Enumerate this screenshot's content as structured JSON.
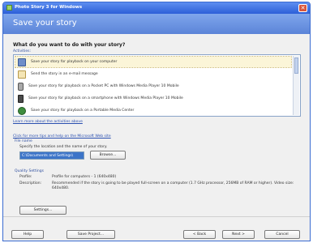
{
  "window": {
    "title": "Photo Story 3 for Windows",
    "close_glyph": "✕"
  },
  "header": {
    "title": "Save your story"
  },
  "main": {
    "question": "What do you want to do with your story?",
    "activities_label": "Activities:",
    "activities": [
      {
        "icon": "computer-icon",
        "label": "Save your story for playback on your computer"
      },
      {
        "icon": "email-icon",
        "label": "Send the story in an e-mail message"
      },
      {
        "icon": "pocket-pc-icon",
        "label": "Save your story for playback on a Pocket PC with Windows Media Player 10 Mobile"
      },
      {
        "icon": "smartphone-icon",
        "label": "Save your story for playback on a smartphone with Windows Media Player 10 Mobile"
      },
      {
        "icon": "media-center-icon",
        "label": "Save your story for playback on a Portable Media Center"
      }
    ],
    "selected_index": 0,
    "learn_link": "Learn more about the activities above",
    "info_link": "Click for more tips and help on the Microsoft Web site",
    "file": {
      "section_label": "File name",
      "description": "Specify the location and the name of your story.",
      "path_value": "C:\\Documents and Settings\\",
      "browse_label": "Browse..."
    },
    "quality": {
      "section_label": "Quality Settings",
      "profile_label": "Profile:",
      "profile_value": "Profile for computers - 1 (640x480)",
      "description_label": "Description:",
      "description_value": "Recommended if the story is going to be played full-screen on a computer (1.7 GHz processor, 256MB of RAM or higher). Video size: 640x480.",
      "settings_button": "Settings..."
    }
  },
  "footer": {
    "help": "Help",
    "save_project": "Save Project...",
    "back": "< Back",
    "next": "Next >",
    "cancel": "Cancel"
  }
}
